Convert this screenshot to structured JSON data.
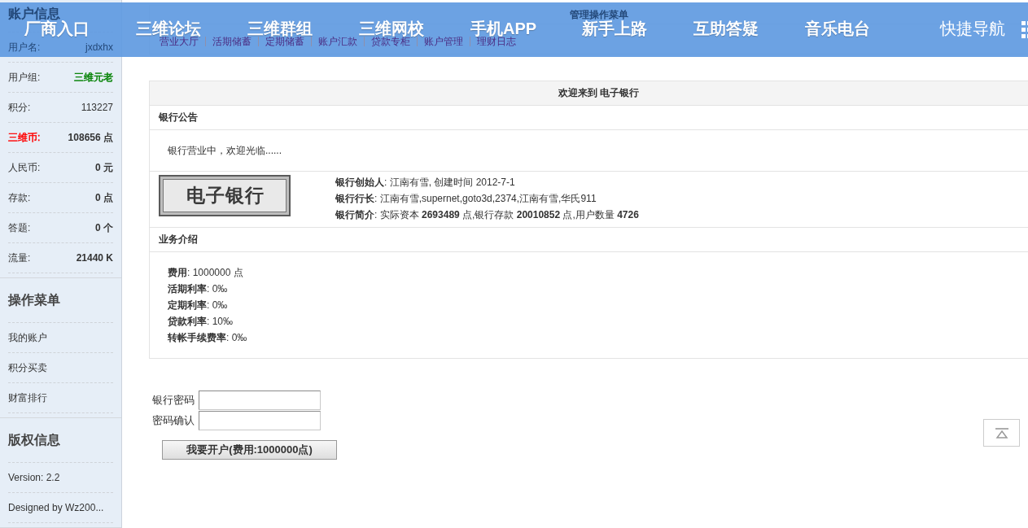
{
  "top_nav": {
    "items": [
      "厂商入口",
      "三维论坛",
      "三维群组",
      "三维网校",
      "手机APP",
      "新手上路",
      "互助答疑",
      "音乐电台"
    ],
    "quick_nav": "快捷导航"
  },
  "sidebar": {
    "sections": [
      {
        "kind": "stats",
        "title": "账户信息",
        "rows": [
          {
            "label": {
              "text": "用户名:"
            },
            "value": {
              "text": "jxdxhx",
              "bold": false
            }
          },
          {
            "label": {
              "text": "用户组:"
            },
            "value": {
              "text": "三维元老",
              "bold": false,
              "color": "#008000"
            }
          },
          {
            "label": {
              "text": "积分:"
            },
            "value": {
              "text": "113227",
              "bold": false
            }
          },
          {
            "label": {
              "text": "三维币:",
              "color": "#ff0000"
            },
            "value": {
              "text": "108656 点",
              "bold": true
            }
          },
          {
            "label": {
              "text": "人民币:"
            },
            "value": {
              "text": "0 元",
              "bold": true
            }
          },
          {
            "label": {
              "text": "存款:"
            },
            "value": {
              "text": "0 点",
              "bold": true
            }
          },
          {
            "label": {
              "text": "答题:"
            },
            "value": {
              "text": "0 个",
              "bold": true
            }
          },
          {
            "label": {
              "text": "流量:"
            },
            "value": {
              "text": "21440 K",
              "bold": true
            }
          }
        ]
      },
      {
        "kind": "links",
        "title": "操作菜单",
        "items": [
          "我的账户",
          "积分买卖",
          "财富排行"
        ]
      },
      {
        "kind": "text",
        "title": "版权信息",
        "lines": [
          "Version: 2.2",
          "Designed by Wz200..."
        ]
      }
    ]
  },
  "admin_menu": {
    "title": "管理操作菜单",
    "links": [
      "营业大厅",
      "活期储蓄",
      "定期储蓄",
      "账户汇款",
      "贷款专柜",
      "账户管理",
      "理财日志"
    ]
  },
  "bank": {
    "title": "欢迎来到 电子银行",
    "notice_heading": "银行公告",
    "notice": "银行营业中，欢迎光临......",
    "logo_text": "电子银行",
    "info": [
      "**银行创始人**: 江南有雪, 创建时间 2012-7-1",
      "**银行行长**: 江南有雪,supernet,goto3d,2374,江南有雪,华氏911",
      "**银行简介**: 实际资本 **2693489** 点,银行存款 **20010852** 点,用户数量 **4726**"
    ],
    "business_heading": "业务介绍",
    "business": [
      "**费用**: 1000000 点",
      "**活期利率**: 0‰",
      "**定期利率**: 0‰",
      "**贷款利率**: 10‰",
      "**转帐手续费率**: 0‰"
    ]
  },
  "open_account": {
    "fields": [
      {
        "label": "银行密码"
      },
      {
        "label": "密码确认"
      }
    ],
    "button": "我要开户(费用:1000000点)"
  }
}
